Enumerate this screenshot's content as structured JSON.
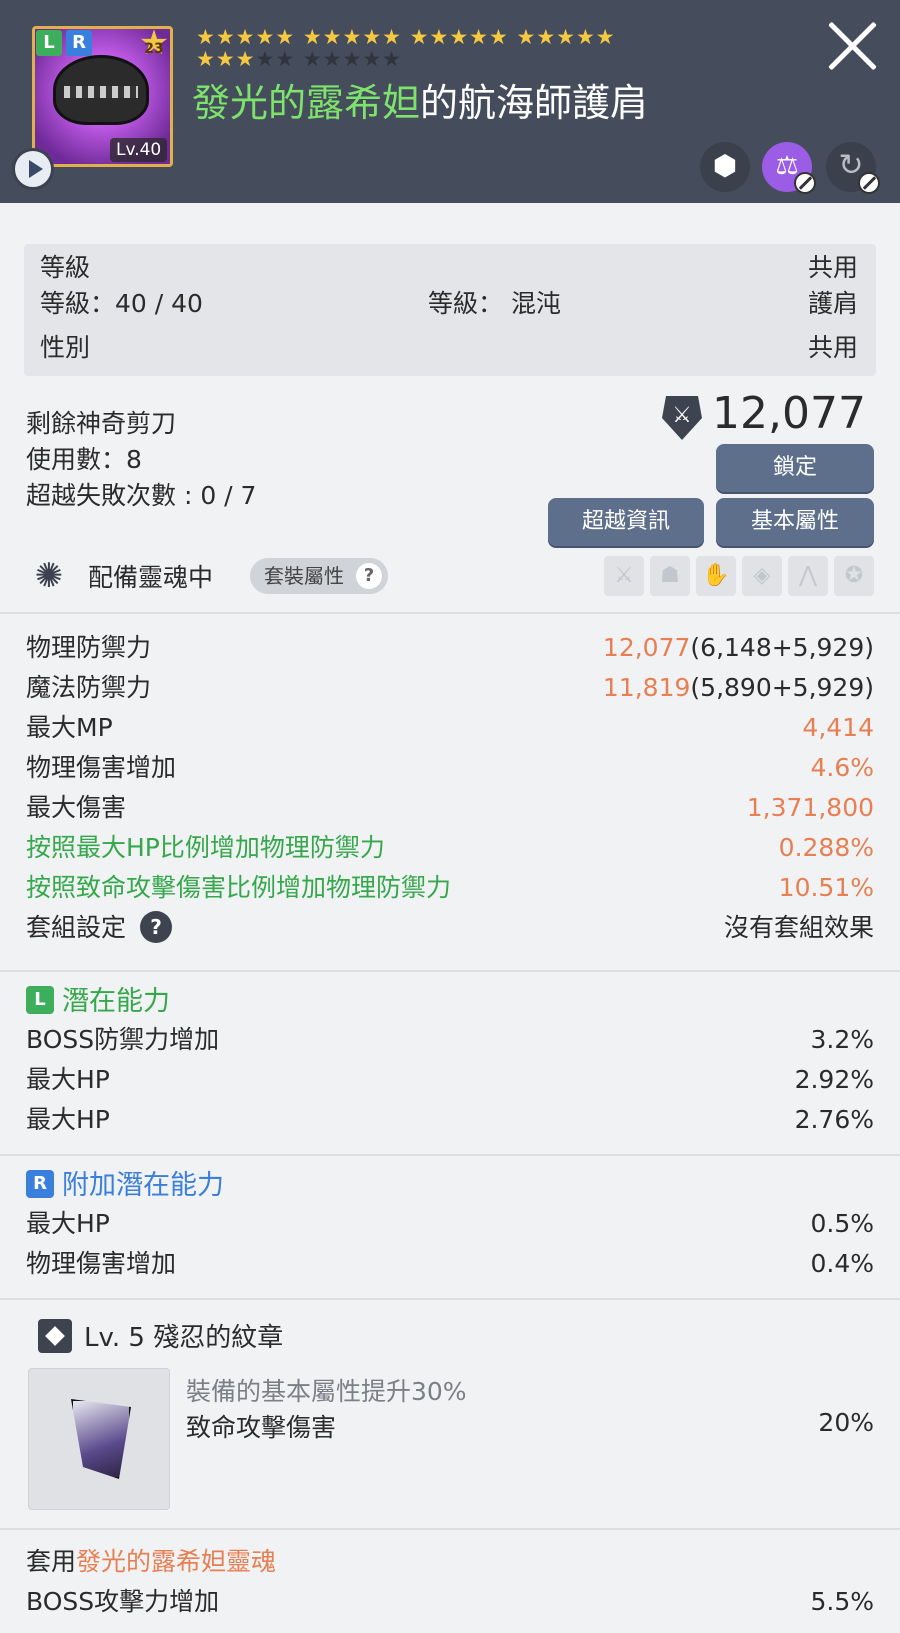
{
  "header": {
    "item_level_tag": "Lv.40",
    "potential_badge": "L",
    "additional_badge": "R",
    "star_force_count": "23",
    "stars_filled": 23,
    "stars_total": 30,
    "title_highlight": "發光的露希妲",
    "title_rest": "的航海師護肩"
  },
  "info": {
    "row1_left": "等級",
    "row1_right": "共用",
    "row2_left": "等級：40 / 40",
    "row2_mid": "等級： 混沌",
    "row2_right": "護肩",
    "row3_left": "性別",
    "row3_right": "共用"
  },
  "upgrade": {
    "scissors_label": "剩餘神奇剪刀",
    "uses": "使用數：8",
    "fail_count": "超越失敗次數 : 0 / 7",
    "combat_power": "12,077",
    "lock_button": "鎖定",
    "transcend_button": "超越資訊",
    "basic_button": "基本屬性"
  },
  "soul": {
    "label": "配備靈魂中",
    "set_attr_label": "套裝屬性",
    "set_attr_q": "?"
  },
  "stats": [
    {
      "key": "物理防禦力",
      "val_main": "12,077",
      "val_extra": "(6,148+5,929)",
      "key_color": "default"
    },
    {
      "key": "魔法防禦力",
      "val_main": "11,819",
      "val_extra": "(5,890+5,929)",
      "key_color": "default"
    },
    {
      "key": "最大MP",
      "val_main": "4,414",
      "val_extra": "",
      "key_color": "default"
    },
    {
      "key": "物理傷害增加",
      "val_main": "4.6%",
      "val_extra": "",
      "key_color": "default"
    },
    {
      "key": "最大傷害",
      "val_main": "1,371,800",
      "val_extra": "",
      "key_color": "default"
    },
    {
      "key": "按照最大HP比例增加物理防禦力",
      "val_main": "0.288%",
      "val_extra": "",
      "key_color": "green"
    },
    {
      "key": "按照致命攻擊傷害比例增加物理防禦力",
      "val_main": "10.51%",
      "val_extra": "",
      "key_color": "green"
    }
  ],
  "set_row": {
    "key": "套組設定",
    "q": "?",
    "value": "沒有套組效果"
  },
  "potential": {
    "badge": "L",
    "title": "潛在能力",
    "lines": [
      {
        "key": "BOSS防禦力增加",
        "value": "3.2%"
      },
      {
        "key": "最大HP",
        "value": "2.92%"
      },
      {
        "key": "最大HP",
        "value": "2.76%"
      }
    ]
  },
  "additional": {
    "badge": "R",
    "title": "附加潛在能力",
    "lines": [
      {
        "key": "最大HP",
        "value": "0.5%"
      },
      {
        "key": "物理傷害增加",
        "value": "0.4%"
      }
    ]
  },
  "emblem": {
    "title": "Lv. 5 殘忍的紋章",
    "desc": "裝備的基本屬性提升30%",
    "stat_key": "致命攻擊傷害",
    "stat_value": "20%"
  },
  "soul_apply": {
    "prefix": "套用",
    "soul_name": "發光的露希妲靈魂",
    "stat_key": "BOSS攻擊力增加",
    "stat_value": "5.5%"
  },
  "colors": {
    "header_bg": "#454c5b",
    "accent_orange": "#e87f52",
    "accent_green": "#35a84b",
    "accent_blue": "#3a7fdc",
    "button_bg": "#5e6f8b"
  }
}
